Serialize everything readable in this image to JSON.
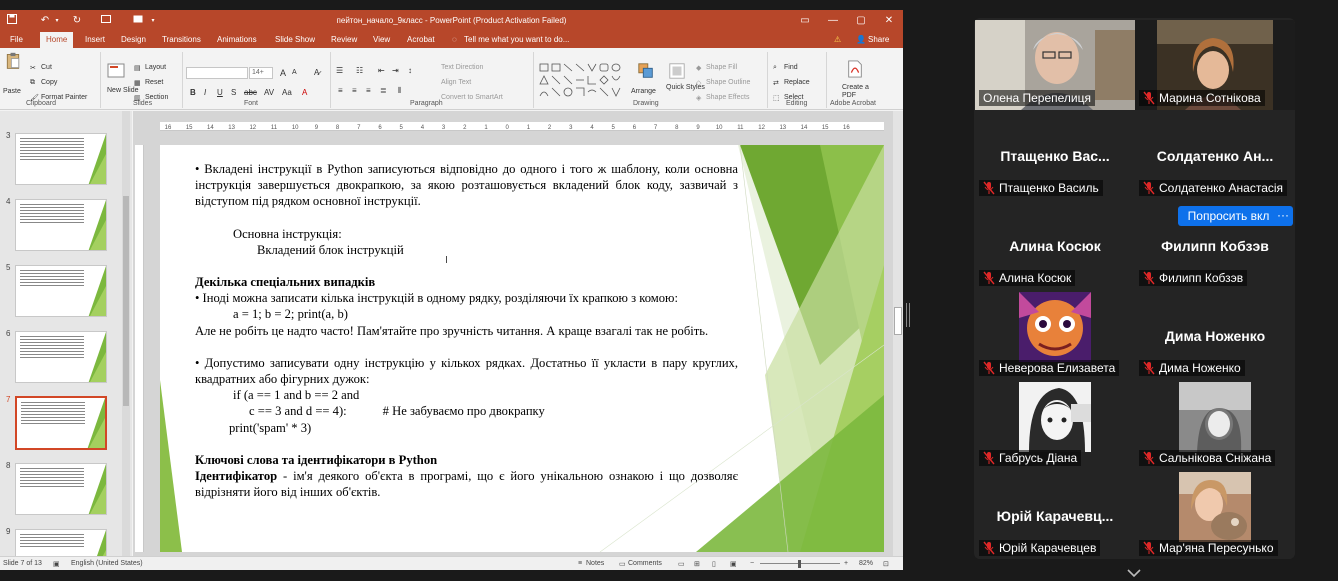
{
  "ppt": {
    "title": "пейтон_начало_9класс - PowerPoint (Product Activation Failed)",
    "tabs": [
      "File",
      "Home",
      "Insert",
      "Design",
      "Transitions",
      "Animations",
      "Slide Show",
      "Review",
      "View",
      "Acrobat"
    ],
    "active_tab": "Home",
    "tell_me": "Tell me what you want to do...",
    "share": "Share",
    "ribbon": {
      "paste": "Paste",
      "cut": "Cut",
      "copy": "Copy",
      "format_painter": "Format Painter",
      "clipboard": "Clipboard",
      "new_slide": "New Slide",
      "layout": "Layout",
      "reset": "Reset",
      "section": "Section",
      "slides": "Slides",
      "font_size": "14+",
      "font": "Font",
      "text_direction": "Text Direction",
      "align_text": "Align Text",
      "convert_smartart": "Convert to SmartArt",
      "paragraph": "Paragraph",
      "arrange": "Arrange",
      "quick_styles": "Quick Styles",
      "shape_fill": "Shape Fill",
      "shape_outline": "Shape Outline",
      "shape_effects": "Shape Effects",
      "drawing": "Drawing",
      "find": "Find",
      "replace": "Replace",
      "select": "Select",
      "editing": "Editing",
      "create_pdf": "Create a PDF",
      "adobe_acrobat": "Adobe Acrobat"
    },
    "ruler_ticks": [
      "16",
      "15",
      "14",
      "13",
      "12",
      "11",
      "10",
      "9",
      "8",
      "7",
      "6",
      "5",
      "4",
      "3",
      "2",
      "1",
      "0",
      "1",
      "2",
      "3",
      "4",
      "5",
      "6",
      "7",
      "8",
      "9",
      "10",
      "11",
      "12",
      "13",
      "14",
      "15",
      "16"
    ],
    "thumbnails": [
      {
        "num": "3",
        "active": false
      },
      {
        "num": "4",
        "active": false
      },
      {
        "num": "5",
        "active": false
      },
      {
        "num": "6",
        "active": false
      },
      {
        "num": "7",
        "active": true
      },
      {
        "num": "8",
        "active": false
      },
      {
        "num": "9",
        "active": false
      }
    ],
    "slide": {
      "p1": "• Вкладені інструкції в Python записуються відповідно до одного і того ж шаблону, коли основна інструкція завершується двокрапкою, за якою розташовується вкладений блок коду, зазвичай з відступом під рядком основної інструкції.",
      "code1": "Основна інструкція:",
      "code2": "Вкладений блок інструкцій",
      "h1": "Декілька спеціальних випадків",
      "p2": "• Іноді можна записати кілька інструкцій в одному рядку, розділяючи їх крапкою з комою:",
      "code3": "a = 1; b = 2; print(a, b)",
      "p3": "Але не робіть це надто часто! Пам'ятайте про зручність читання. А краще взагалі так не робіть.",
      "p4": "• Допустимо записувати одну інструкцію у кількох рядках. Достатньо її укласти в пару круглих, квадратних або фігурних дужок:",
      "code4": "if (a == 1 and b == 2 and",
      "code5": "c == 3 and d == 4):",
      "code5_comment": "# Не забуваємо про двокрапку",
      "code6": "print('spam' * 3)",
      "h2": "Ключові слова та ідентифікатори в Python",
      "p5_bold": "Ідентифікатор",
      "p5": " - ім'я деякого об'єкта в програмі, що є його унікальною ознакою і що дозволяє відрізняти його від інших об'єктів."
    },
    "status": {
      "slide_of": "Slide 7 of 13",
      "language": "English (United States)",
      "notes": "Notes",
      "comments": "Comments",
      "zoom": "82%"
    }
  },
  "zoom": {
    "participants": [
      {
        "name": "Олена Перепелиця",
        "big": "",
        "type": "video",
        "speaking": true,
        "muted": false
      },
      {
        "name": "Марина Сотнікова",
        "big": "",
        "type": "video",
        "speaking": false,
        "muted": true
      },
      {
        "name": "Птащенко Василь",
        "big": "Птащенко Вас...",
        "type": "name",
        "muted": true
      },
      {
        "name": "Солдатенко Анастасія",
        "big": "Солдатенко Ан...",
        "type": "name",
        "muted": true
      },
      {
        "name": "Алина Косюк",
        "big": "Алина Косюк",
        "type": "name",
        "muted": true
      },
      {
        "name": "Филипп Кобзэв",
        "big": "Филипп Кобзэв",
        "type": "name",
        "muted": true
      },
      {
        "name": "Неверова Елизавета",
        "big": "",
        "type": "photo",
        "muted": true
      },
      {
        "name": "Дима Ноженко",
        "big": "Дима Ноженко",
        "type": "name",
        "muted": true
      },
      {
        "name": "Габрусь Діана",
        "big": "",
        "type": "photo",
        "muted": true
      },
      {
        "name": "Сальнікова Сніжана",
        "big": "",
        "type": "photo",
        "muted": true
      },
      {
        "name": "Юрій Карачевцев",
        "big": "Юрій Карачевц...",
        "type": "name",
        "muted": true
      },
      {
        "name": "Мар'яна Пересунько",
        "big": "",
        "type": "photo",
        "muted": true
      }
    ],
    "ask_button": "Попросить вкл",
    "more_button": "···",
    "colors": {
      "speaking": "#23d959",
      "accent": "#0e71eb",
      "muted": "#e02828"
    }
  }
}
